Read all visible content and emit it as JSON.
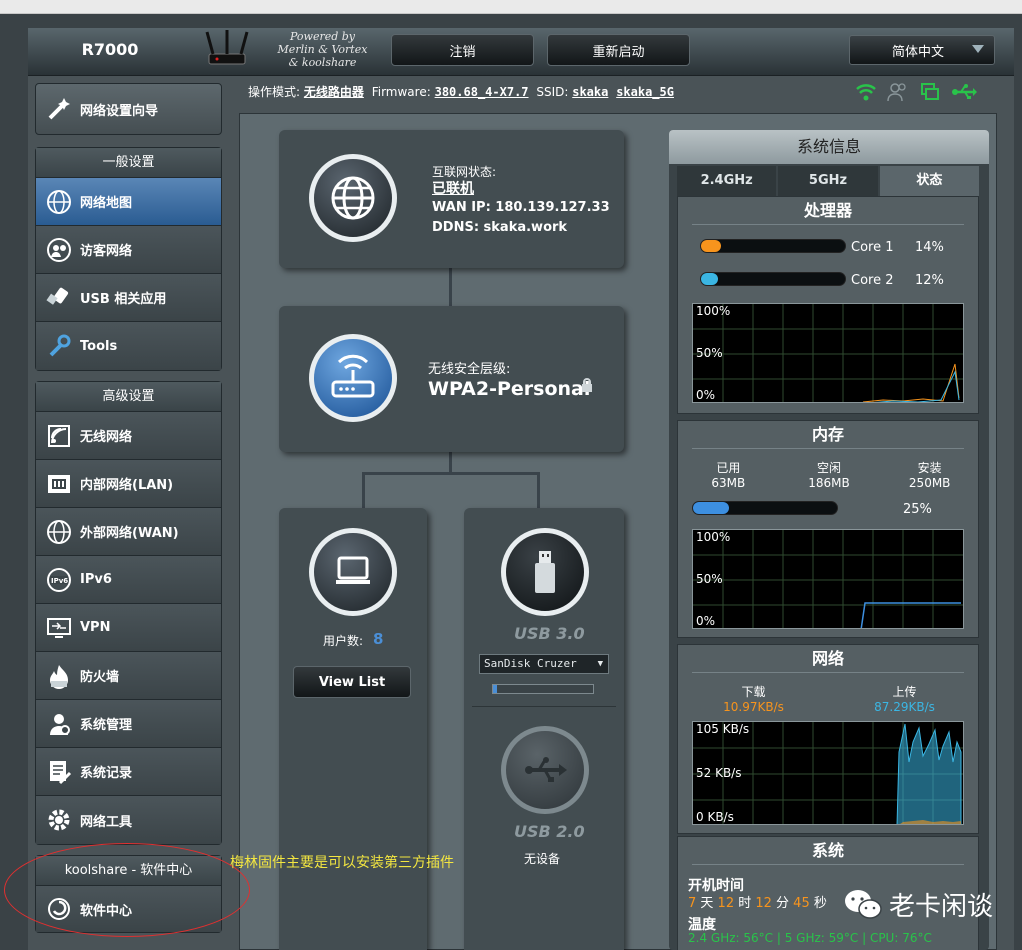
{
  "header": {
    "model": "R7000",
    "powered": [
      "Powered by",
      "Merlin & Vortex",
      "& koolshare"
    ],
    "logout": "注销",
    "reboot": "重新启动",
    "language": "简体中文"
  },
  "infobar": {
    "mode_label": "操作模式:",
    "mode_value": "无线路由器",
    "firmware_label": "Firmware:",
    "firmware_value": "380.68_4-X7.7",
    "ssid_label": "SSID:",
    "ssid_1": "skaka",
    "ssid_2": "skaka_5G"
  },
  "sidebar": {
    "wizard": "网络设置向导",
    "general_title": "一般设置",
    "general": [
      {
        "label": "网络地图",
        "icon": "network-map-icon",
        "active": true
      },
      {
        "label": "访客网络",
        "icon": "guest-network-icon"
      },
      {
        "label": "USB 相关应用",
        "icon": "usb-app-icon"
      },
      {
        "label": "Tools",
        "icon": "wrench-icon"
      }
    ],
    "advanced_title": "高级设置",
    "advanced": [
      {
        "label": "无线网络",
        "icon": "wireless-icon"
      },
      {
        "label": "内部网络(LAN)",
        "icon": "lan-icon"
      },
      {
        "label": "外部网络(WAN)",
        "icon": "wan-globe-icon"
      },
      {
        "label": "IPv6",
        "icon": "ipv6-icon"
      },
      {
        "label": "VPN",
        "icon": "vpn-icon"
      },
      {
        "label": "防火墙",
        "icon": "firewall-icon"
      },
      {
        "label": "系统管理",
        "icon": "admin-icon"
      },
      {
        "label": "系统记录",
        "icon": "log-icon"
      },
      {
        "label": "网络工具",
        "icon": "network-tools-icon"
      }
    ],
    "koolshare_title": "koolshare - 软件中心",
    "software_center": "软件中心"
  },
  "map": {
    "internet_status_label": "互联网状态:",
    "internet_status": "已联机",
    "wan_ip": "WAN IP: 180.139.127.33",
    "ddns": "DDNS: skaka.work",
    "security_label": "无线安全层级:",
    "security_value": "WPA2-Personal",
    "clients_label": "用户数:",
    "clients_count": "8",
    "view_list": "View List",
    "usb3_label": "USB 3.0",
    "usb3_device": "SanDisk Cruzer",
    "usb2_label": "USB 2.0",
    "usb2_status": "无设备"
  },
  "sysinfo": {
    "title": "系统信息",
    "tabs": [
      "2.4GHz",
      "5GHz",
      "状态"
    ],
    "cpu_title": "处理器",
    "cores": [
      {
        "name": "Core 1",
        "percent": "14%",
        "value": 14,
        "color": "#f7941d"
      },
      {
        "name": "Core 2",
        "percent": "12%",
        "value": 12,
        "color": "#3bb6e3"
      }
    ],
    "cpu_graph_labels": [
      "100%",
      "50%",
      "0%"
    ],
    "mem_title": "内存",
    "mem_cols": [
      {
        "label": "已用",
        "value": "63MB"
      },
      {
        "label": "空闲",
        "value": "186MB"
      },
      {
        "label": "安装",
        "value": "250MB"
      }
    ],
    "mem_percent": "25%",
    "mem_value": 25,
    "mem_graph_labels": [
      "100%",
      "50%",
      "0%"
    ],
    "net_title": "网络",
    "download_label": "下载",
    "download_value": "10.97KB/s",
    "upload_label": "上传",
    "upload_value": "87.29KB/s",
    "net_graph_labels": [
      "105 KB/s",
      "52 KB/s",
      "0 KB/s"
    ],
    "sys_title": "系统",
    "uptime_label": "开机时间",
    "uptime": [
      {
        "n": "7",
        "u": " 天 "
      },
      {
        "n": "12",
        "u": " 时 "
      },
      {
        "n": "12",
        "u": " 分 "
      },
      {
        "n": "45",
        "u": " 秒"
      }
    ],
    "temp_label": "温度",
    "temps": "2.4 GHz: 56°C | 5 GHz: 59°C | CPU: 76°C"
  },
  "overlay": {
    "annotation": "梅林固件主要是可以安装第三方插件",
    "watermark": "老卡闲谈"
  },
  "colors": {
    "accent": "#4b8fd6",
    "orange": "#f7941d",
    "cyan": "#3bb6e3",
    "green": "#29c34a"
  }
}
